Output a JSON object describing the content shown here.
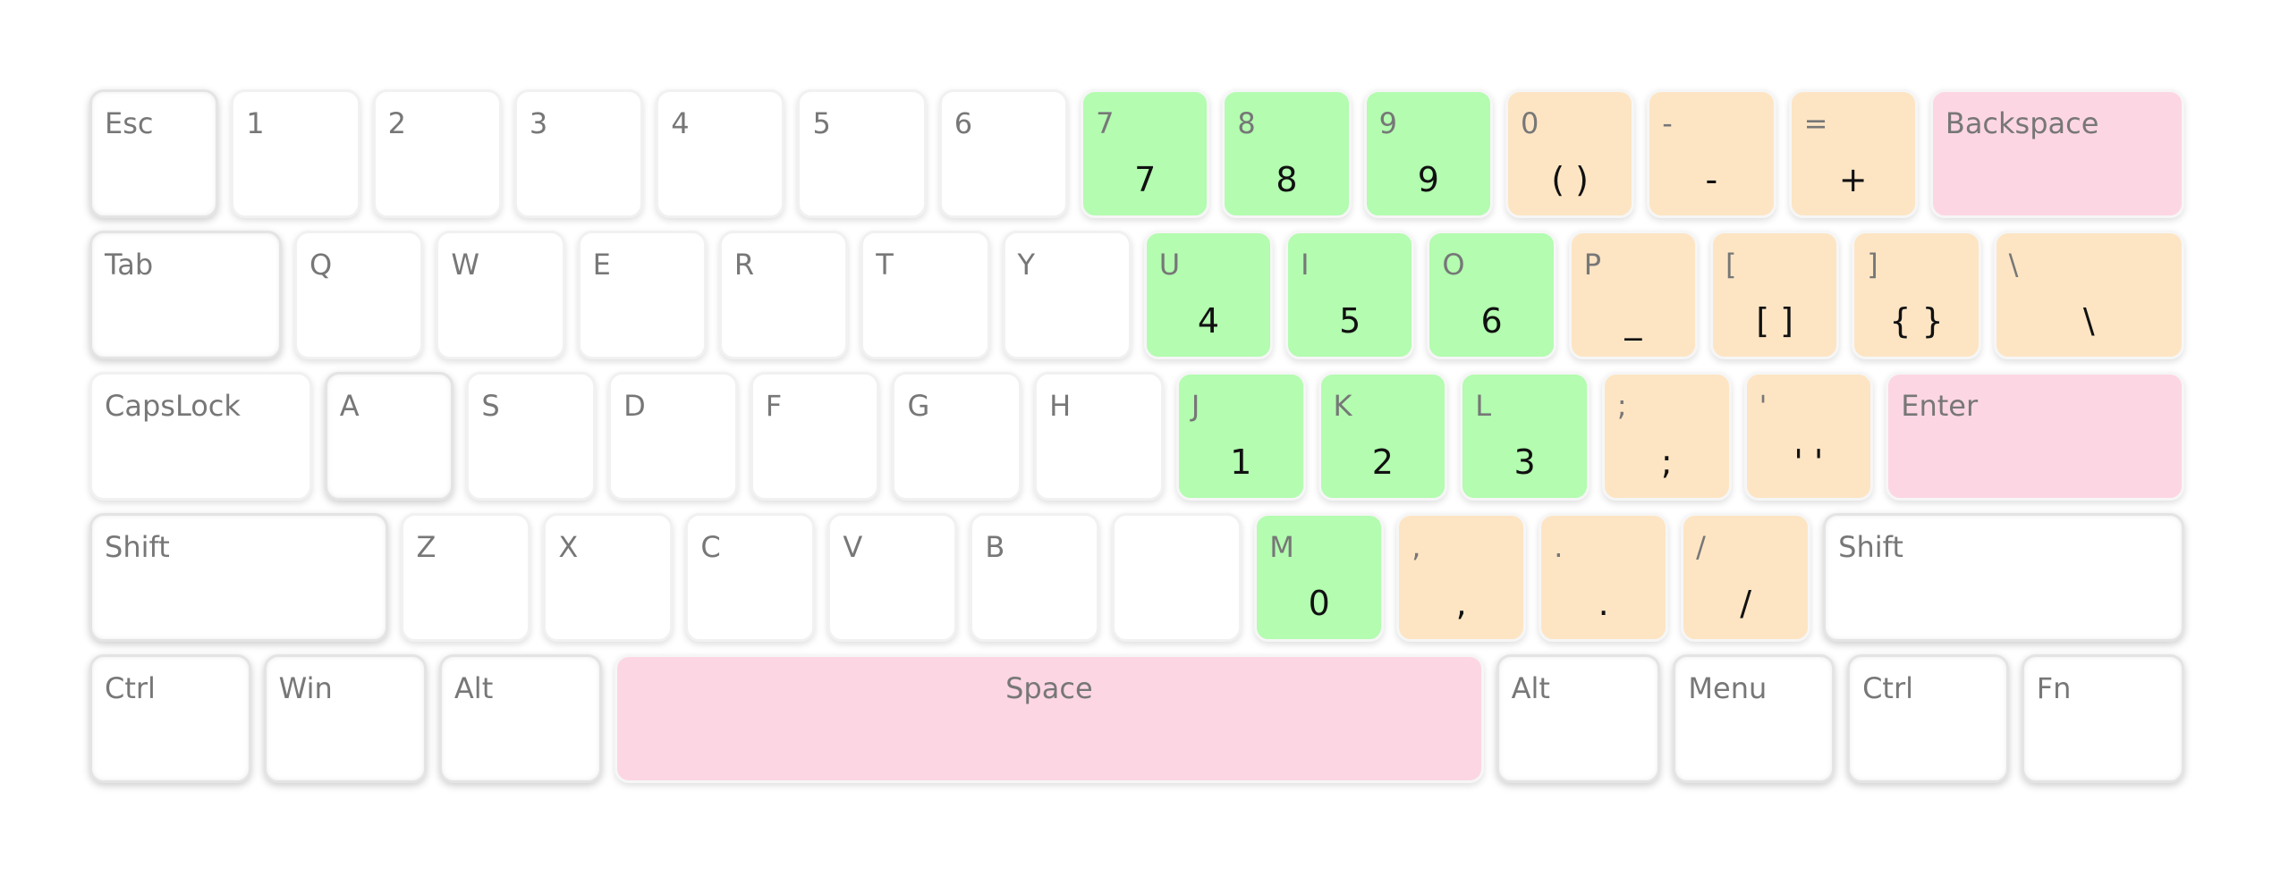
{
  "colors": {
    "green": "#b3fcb0",
    "orange": "#fde5c4",
    "pink": "#fdd6e4",
    "white": "#ffffff"
  },
  "rows": [
    [
      {
        "top": "Esc",
        "main": "",
        "color": "white",
        "w": 88,
        "mod": true
      },
      {
        "top": "1",
        "main": "",
        "color": "white",
        "w": 88
      },
      {
        "top": "2",
        "main": "",
        "color": "white",
        "w": 88
      },
      {
        "top": "3",
        "main": "",
        "color": "white",
        "w": 88
      },
      {
        "top": "4",
        "main": "",
        "color": "white",
        "w": 88
      },
      {
        "top": "5",
        "main": "",
        "color": "white",
        "w": 88
      },
      {
        "top": "6",
        "main": "",
        "color": "white",
        "w": 88
      },
      {
        "top": "7",
        "main": "7",
        "color": "green",
        "w": 88
      },
      {
        "top": "8",
        "main": "8",
        "color": "green",
        "w": 88
      },
      {
        "top": "9",
        "main": "9",
        "color": "green",
        "w": 88
      },
      {
        "top": "0",
        "main": "( )",
        "color": "orange",
        "w": 88
      },
      {
        "top": "-",
        "main": "-",
        "color": "orange",
        "w": 88
      },
      {
        "top": "=",
        "main": "+",
        "color": "orange",
        "w": 88
      },
      {
        "top": "Backspace",
        "main": "",
        "color": "pink",
        "w": 177
      }
    ],
    [
      {
        "top": "Tab",
        "main": "",
        "color": "white",
        "w": 133,
        "mod": true
      },
      {
        "top": "Q",
        "main": "",
        "color": "white",
        "w": 88
      },
      {
        "top": "W",
        "main": "",
        "color": "white",
        "w": 88
      },
      {
        "top": "E",
        "main": "",
        "color": "white",
        "w": 88
      },
      {
        "top": "R",
        "main": "",
        "color": "white",
        "w": 88
      },
      {
        "top": "T",
        "main": "",
        "color": "white",
        "w": 88
      },
      {
        "top": "Y",
        "main": "",
        "color": "white",
        "w": 88
      },
      {
        "top": "U",
        "main": "4",
        "color": "green",
        "w": 88
      },
      {
        "top": "I",
        "main": "5",
        "color": "green",
        "w": 88
      },
      {
        "top": "O",
        "main": "6",
        "color": "green",
        "w": 88
      },
      {
        "top": "P",
        "main": "_",
        "color": "orange",
        "w": 88
      },
      {
        "top": "[",
        "main": "[ ]",
        "color": "orange",
        "w": 88
      },
      {
        "top": "]",
        "main": "{ }",
        "color": "orange",
        "w": 88
      },
      {
        "top": "\\",
        "main": "\\",
        "color": "orange",
        "w": 132
      }
    ],
    [
      {
        "top": "CapsLock",
        "main": "",
        "color": "white",
        "w": 154
      },
      {
        "top": "A",
        "main": "",
        "color": "white",
        "w": 88,
        "mod": true
      },
      {
        "top": "S",
        "main": "",
        "color": "white",
        "w": 88
      },
      {
        "top": "D",
        "main": "",
        "color": "white",
        "w": 88
      },
      {
        "top": "F",
        "main": "",
        "color": "white",
        "w": 88
      },
      {
        "top": "G",
        "main": "",
        "color": "white",
        "w": 88
      },
      {
        "top": "H",
        "main": "",
        "color": "white",
        "w": 88
      },
      {
        "top": "J",
        "main": "1",
        "color": "green",
        "w": 88
      },
      {
        "top": "K",
        "main": "2",
        "color": "green",
        "w": 88
      },
      {
        "top": "L",
        "main": "3",
        "color": "green",
        "w": 88
      },
      {
        "top": ";",
        "main": ";",
        "color": "orange",
        "w": 88
      },
      {
        "top": "'",
        "main": "' '",
        "color": "orange",
        "w": 88
      },
      {
        "top": "Enter",
        "main": "",
        "color": "pink",
        "w": 208
      }
    ],
    [
      {
        "top": "Shift",
        "main": "",
        "color": "white",
        "w": 208,
        "mod": true
      },
      {
        "top": "Z",
        "main": "",
        "color": "white",
        "w": 88
      },
      {
        "top": "X",
        "main": "",
        "color": "white",
        "w": 88
      },
      {
        "top": "C",
        "main": "",
        "color": "white",
        "w": 88
      },
      {
        "top": "V",
        "main": "",
        "color": "white",
        "w": 88
      },
      {
        "top": "B",
        "main": "",
        "color": "white",
        "w": 88
      },
      {
        "top": "",
        "main": "",
        "color": "white",
        "w": 88
      },
      {
        "top": "M",
        "main": "0",
        "color": "green",
        "w": 88
      },
      {
        "top": ",",
        "main": ",",
        "color": "orange",
        "w": 88
      },
      {
        "top": ".",
        "main": ".",
        "color": "orange",
        "w": 88
      },
      {
        "top": "/",
        "main": "/",
        "color": "orange",
        "w": 88
      },
      {
        "top": "Shift",
        "main": "",
        "color": "white",
        "w": 252,
        "mod": true
      }
    ],
    [
      {
        "top": "Ctrl",
        "main": "",
        "color": "white",
        "w": 110,
        "mod": true
      },
      {
        "top": "Win",
        "main": "",
        "color": "white",
        "w": 111,
        "mod": true
      },
      {
        "top": "Alt",
        "main": "",
        "color": "white",
        "w": 111,
        "mod": true
      },
      {
        "top": "Space",
        "main": "",
        "color": "pink",
        "w": 608,
        "center": true
      },
      {
        "top": "Alt",
        "main": "",
        "color": "white",
        "w": 112,
        "mod": true
      },
      {
        "top": "Menu",
        "main": "",
        "color": "white",
        "w": 110,
        "mod": true
      },
      {
        "top": "Ctrl",
        "main": "",
        "color": "white",
        "w": 110,
        "mod": true
      },
      {
        "top": "Fn",
        "main": "",
        "color": "white",
        "w": 111,
        "mod": true
      }
    ]
  ]
}
